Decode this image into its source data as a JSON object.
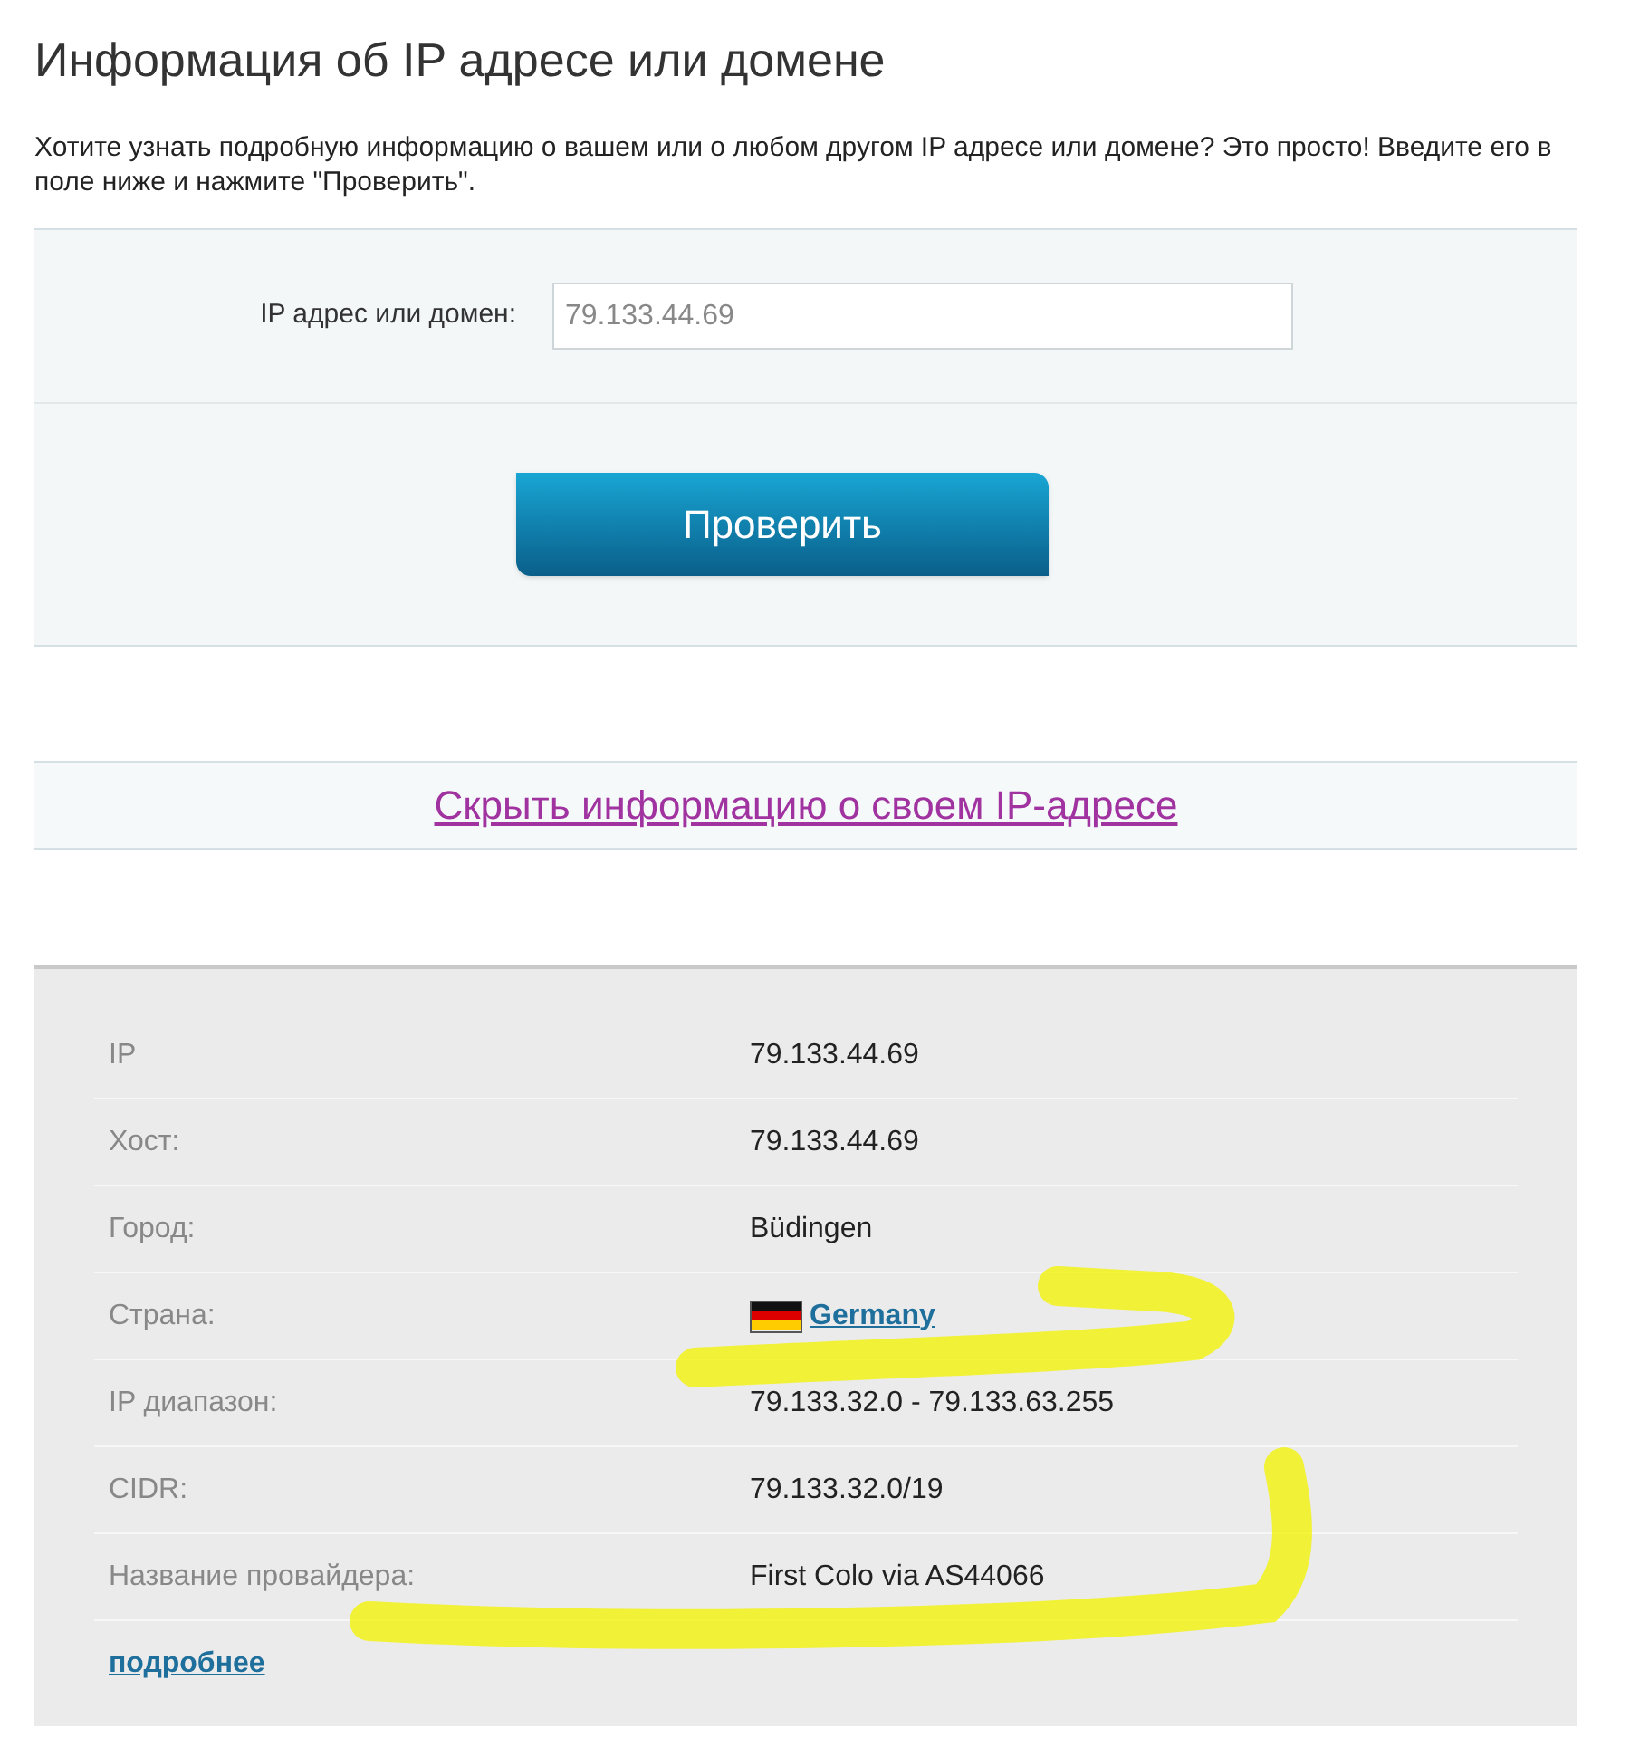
{
  "title": "Информация об IP адресе или домене",
  "intro": "Хотите узнать подробную информацию о вашем или о любом другом IP адресе или домене? Это просто! Введите его в поле ниже и нажмите \"Проверить\".",
  "form": {
    "label": "IP адрес или домен:",
    "placeholder": "79.133.44.69",
    "button": "Проверить"
  },
  "hide_link": "Скрыть информацию о своем IP-адресе",
  "info_rows": [
    {
      "kind": "text",
      "label": "IP",
      "value": "79.133.44.69"
    },
    {
      "kind": "text",
      "label": "Хост:",
      "value": "79.133.44.69"
    },
    {
      "kind": "text",
      "label": "Город:",
      "value": "Büdingen"
    },
    {
      "kind": "flag_link",
      "label": "Страна:",
      "value": "Germany"
    },
    {
      "kind": "text",
      "label": "IP диапазон:",
      "value": "79.133.32.0 - 79.133.63.255"
    },
    {
      "kind": "text",
      "label": "CIDR:",
      "value": "79.133.32.0/19"
    },
    {
      "kind": "text",
      "label": "Название провайдера:",
      "value": "First Colo via AS44066"
    }
  ],
  "more_link": "подробнее"
}
